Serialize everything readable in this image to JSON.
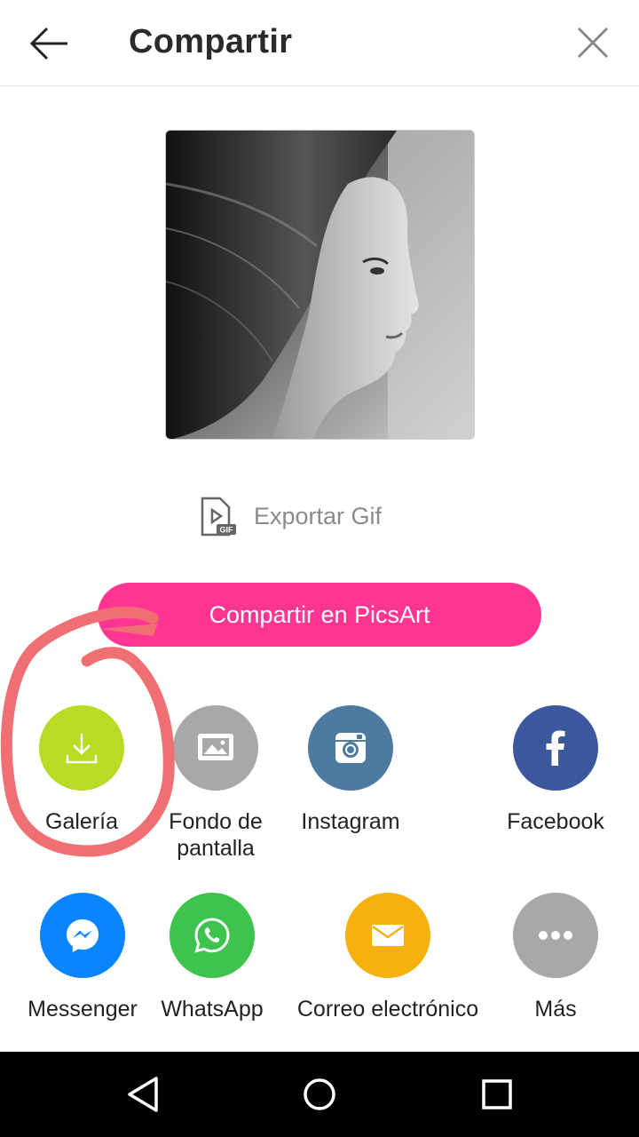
{
  "header": {
    "title": "Compartir",
    "back_icon": "arrow-left-icon",
    "close_icon": "close-icon"
  },
  "preview": {
    "icon": "portrait-photo"
  },
  "export": {
    "label": "Exportar Gif",
    "icon": "gif-file-icon"
  },
  "primary_action": {
    "label": "Compartir en PicsArt",
    "color": "#ff3594"
  },
  "share_targets": [
    {
      "label": "Galería",
      "icon": "download-icon",
      "color": "#b8dc24"
    },
    {
      "label": "Fondo de pantalla",
      "icon": "wallpaper-icon",
      "color": "#a8a8a8"
    },
    {
      "label": "Instagram",
      "icon": "instagram-icon",
      "color": "#4e7aa2"
    },
    {
      "label": "Facebook",
      "icon": "facebook-icon",
      "color": "#3b579d"
    },
    {
      "label": "Messenger",
      "icon": "messenger-icon",
      "color": "#0a84ff"
    },
    {
      "label": "WhatsApp",
      "icon": "whatsapp-icon",
      "color": "#3ec34f"
    },
    {
      "label": "Correo electrónico",
      "icon": "email-icon",
      "color": "#f6b10f"
    },
    {
      "label": "Más",
      "icon": "more-icon",
      "color": "#a8a8a8"
    }
  ],
  "annotation": {
    "color": "#f06f72"
  },
  "system_nav": {
    "back": "nav-back-icon",
    "home": "nav-home-icon",
    "recents": "nav-recents-icon"
  }
}
